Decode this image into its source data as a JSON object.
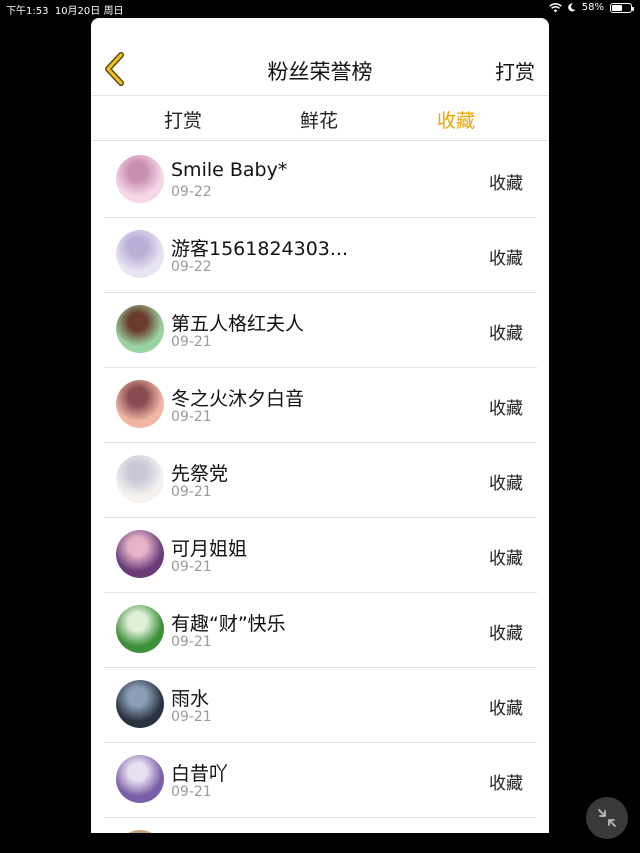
{
  "status_bar": {
    "time": "下午1:53",
    "date": "10月20日 周日",
    "battery_text": "58%",
    "battery_level": 0.58
  },
  "header": {
    "title": "粉丝荣誉榜",
    "right_label": "打赏"
  },
  "tabs": [
    {
      "label": "打赏",
      "active": false
    },
    {
      "label": "鲜花",
      "active": false
    },
    {
      "label": "收藏",
      "active": true
    }
  ],
  "list": [
    {
      "name": "Smile Baby*",
      "date": "09-22",
      "action": "收藏",
      "avatar_colors": [
        "#f4d8e8",
        "#c98fb2"
      ]
    },
    {
      "name": "游客1561824303...",
      "date": "09-22",
      "action": "收藏",
      "avatar_colors": [
        "#e9e4f2",
        "#b9aed6"
      ]
    },
    {
      "name": "第五人格红夫人",
      "date": "09-21",
      "action": "收藏",
      "avatar_colors": [
        "#9ad3a2",
        "#6b3b2e"
      ]
    },
    {
      "name": "冬之火沐夕白音",
      "date": "09-21",
      "action": "收藏",
      "avatar_colors": [
        "#f0b7a4",
        "#8a4c52"
      ]
    },
    {
      "name": "先祭党",
      "date": "09-21",
      "action": "收藏",
      "avatar_colors": [
        "#f4f1ee",
        "#c8c8d8"
      ]
    },
    {
      "name": "可月姐姐",
      "date": "09-21",
      "action": "收藏",
      "avatar_colors": [
        "#6a3c7a",
        "#e6b3c9"
      ]
    },
    {
      "name": "有趣“财”快乐",
      "date": "09-21",
      "action": "收藏",
      "avatar_colors": [
        "#3e8f3a",
        "#dff0d8"
      ]
    },
    {
      "name": "雨水",
      "date": "09-21",
      "action": "收藏",
      "avatar_colors": [
        "#2b3340",
        "#8aa0b8"
      ]
    },
    {
      "name": "白昔吖",
      "date": "09-21",
      "action": "收藏",
      "avatar_colors": [
        "#7a5ea8",
        "#e8dff0"
      ]
    }
  ]
}
